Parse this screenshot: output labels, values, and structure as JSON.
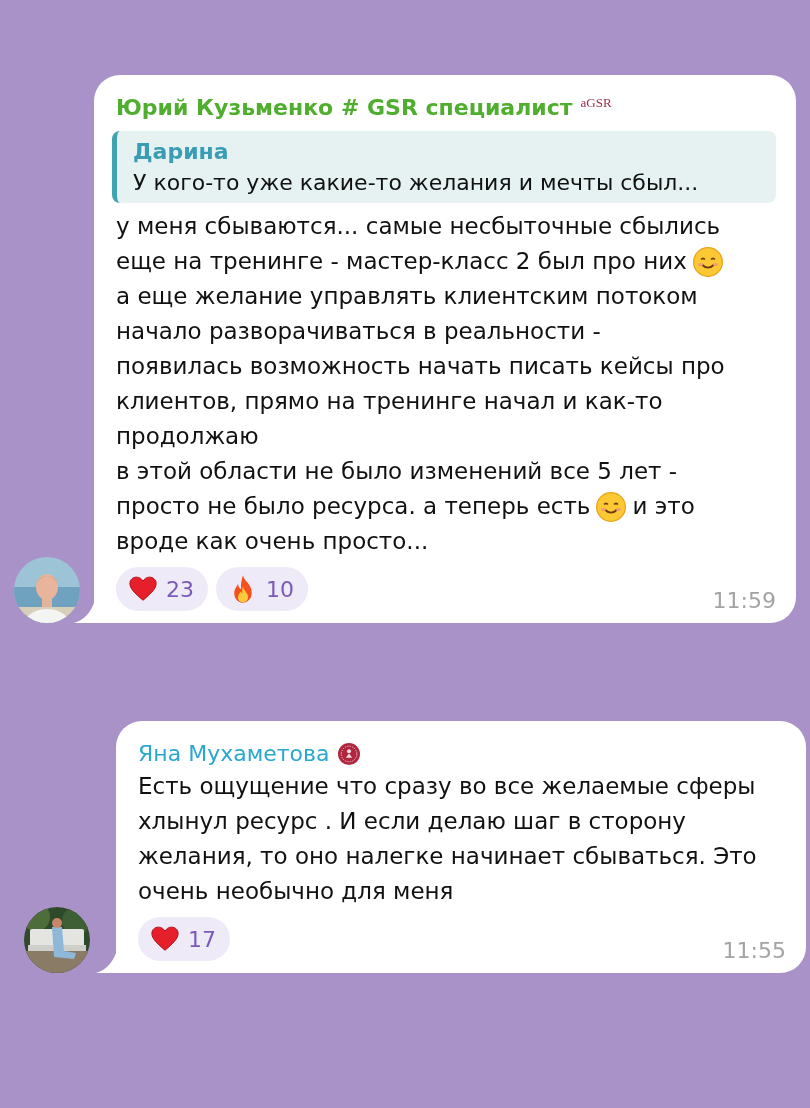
{
  "messages": [
    {
      "author": "Юрий Кузьменко # GSR специалист",
      "author_badge": {
        "kind": "text",
        "text": "aGSR"
      },
      "color": "#4fae2e",
      "reply": {
        "author": "Дарина",
        "text": "У кого-то уже какие-то желания и мечты сбыл..."
      },
      "lines": [
        [
          {
            "kind": "text",
            "text": "у меня сбываются... самые несбыточные сбылись"
          }
        ],
        [
          {
            "kind": "text",
            "text": "еще на тренинге - мастер-класс 2 был про них"
          },
          {
            "kind": "smiley"
          }
        ],
        [
          {
            "kind": "text",
            "text": "а еще желание управлять клиентским потоком"
          }
        ],
        [
          {
            "kind": "text",
            "text": "начало разворачиваться в реальности -"
          }
        ],
        [
          {
            "kind": "text",
            "text": "появилась возможность начать писать кейсы про"
          }
        ],
        [
          {
            "kind": "text",
            "text": "клиентов, прямо на тренинге начал и как-то"
          }
        ],
        [
          {
            "kind": "text",
            "text": "продолжаю"
          }
        ],
        [
          {
            "kind": "text",
            "text": "в этой области не было изменений все 5 лет -"
          }
        ],
        [
          {
            "kind": "text",
            "text": "просто не было ресурса. а теперь есть"
          },
          {
            "kind": "smiley"
          },
          {
            "kind": "text",
            "text": "и это"
          }
        ],
        [
          {
            "kind": "text",
            "text": "вроде как очень просто..."
          }
        ]
      ],
      "reactions": [
        {
          "kind": "heart",
          "count": "23"
        },
        {
          "kind": "fire",
          "count": "10"
        }
      ],
      "time": "11:59"
    },
    {
      "author": "Яна Мухаметова",
      "author_badge": {
        "kind": "seal"
      },
      "color": "#2aa8d0",
      "lines": [
        [
          {
            "kind": "text",
            "text": "Есть ощущение что сразу во все желаемые сферы"
          }
        ],
        [
          {
            "kind": "text",
            "text": "хлынул ресурс . И если делаю шаг в сторону"
          }
        ],
        [
          {
            "kind": "text",
            "text": "желания, то оно налегке начинает сбываться. Это"
          }
        ],
        [
          {
            "kind": "text",
            "text": "очень необычно для меня"
          }
        ]
      ],
      "reactions": [
        {
          "kind": "heart",
          "count": "17"
        }
      ],
      "time": "11:55"
    }
  ]
}
